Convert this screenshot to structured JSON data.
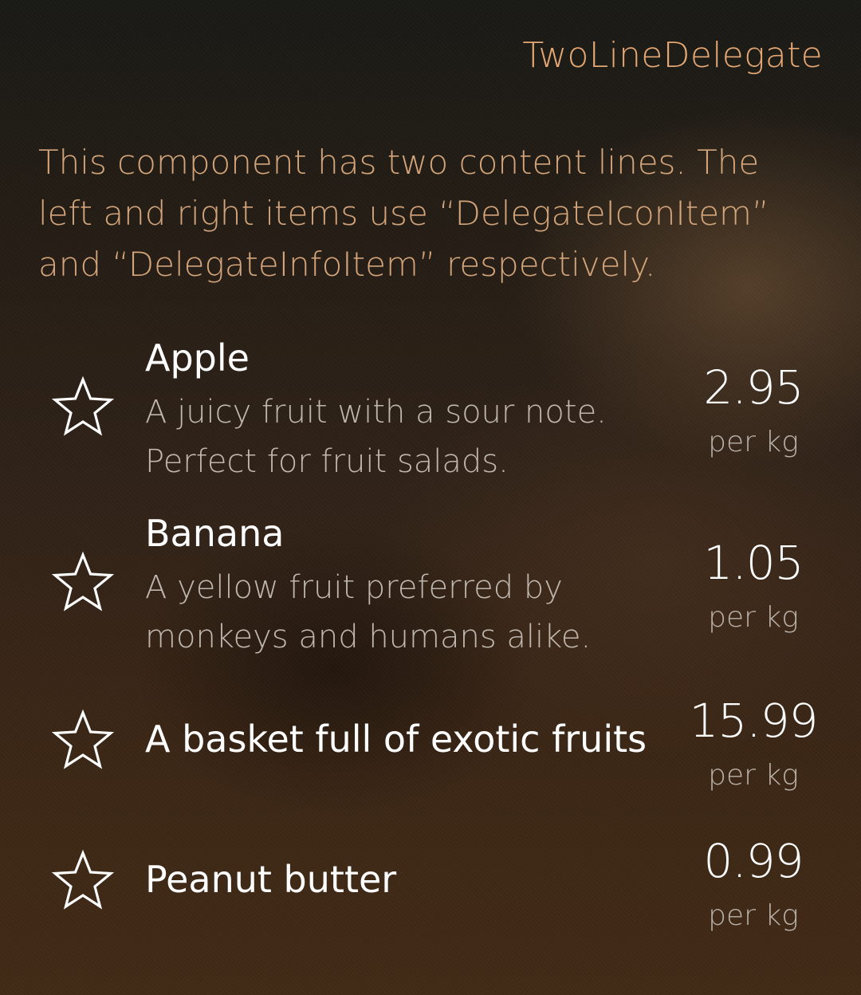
{
  "header": {
    "title": "TwoLineDelegate"
  },
  "description": "This component has two content lines. The left and right items use “DelegateIconItem” and “DelegateInfoItem” respectively.",
  "items": [
    {
      "icon": "star-outline-icon",
      "title": "Apple",
      "description": "A juicy fruit with a sour note. Perfect for fruit salads.",
      "price": "2.95",
      "unit": "per kg"
    },
    {
      "icon": "star-outline-icon",
      "title": "Banana",
      "description": "A yellow fruit preferred by monkeys and humans alike.",
      "price": "1.05",
      "unit": "per kg"
    },
    {
      "icon": "star-outline-icon",
      "title": "A basket full of exotic fruits",
      "description": "",
      "price": "15.99",
      "unit": "per kg"
    },
    {
      "icon": "star-outline-icon",
      "title": "Peanut butter",
      "description": "",
      "price": "0.99",
      "unit": "per kg"
    }
  ],
  "colors": {
    "header_accent": "#e4a774",
    "description_text": "#d3a47a",
    "primary_text": "#ffffff",
    "secondary_text": "#bfb7ae"
  }
}
